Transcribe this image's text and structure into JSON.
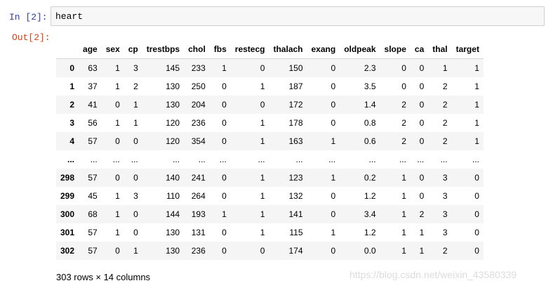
{
  "cell": {
    "input_prompt": "In  [2]:",
    "code": "heart",
    "output_prompt": "Out[2]:"
  },
  "dataframe": {
    "columns": [
      "age",
      "sex",
      "cp",
      "trestbps",
      "chol",
      "fbs",
      "restecg",
      "thalach",
      "exang",
      "oldpeak",
      "slope",
      "ca",
      "thal",
      "target"
    ],
    "rows": [
      {
        "index": "0",
        "values": [
          "63",
          "1",
          "3",
          "145",
          "233",
          "1",
          "0",
          "150",
          "0",
          "2.3",
          "0",
          "0",
          "1",
          "1"
        ]
      },
      {
        "index": "1",
        "values": [
          "37",
          "1",
          "2",
          "130",
          "250",
          "0",
          "1",
          "187",
          "0",
          "3.5",
          "0",
          "0",
          "2",
          "1"
        ]
      },
      {
        "index": "2",
        "values": [
          "41",
          "0",
          "1",
          "130",
          "204",
          "0",
          "0",
          "172",
          "0",
          "1.4",
          "2",
          "0",
          "2",
          "1"
        ]
      },
      {
        "index": "3",
        "values": [
          "56",
          "1",
          "1",
          "120",
          "236",
          "0",
          "1",
          "178",
          "0",
          "0.8",
          "2",
          "0",
          "2",
          "1"
        ]
      },
      {
        "index": "4",
        "values": [
          "57",
          "0",
          "0",
          "120",
          "354",
          "0",
          "1",
          "163",
          "1",
          "0.6",
          "2",
          "0",
          "2",
          "1"
        ]
      },
      {
        "index": "...",
        "values": [
          "...",
          "...",
          "...",
          "...",
          "...",
          "...",
          "...",
          "...",
          "...",
          "...",
          "...",
          "...",
          "...",
          "..."
        ]
      },
      {
        "index": "298",
        "values": [
          "57",
          "0",
          "0",
          "140",
          "241",
          "0",
          "1",
          "123",
          "1",
          "0.2",
          "1",
          "0",
          "3",
          "0"
        ]
      },
      {
        "index": "299",
        "values": [
          "45",
          "1",
          "3",
          "110",
          "264",
          "0",
          "1",
          "132",
          "0",
          "1.2",
          "1",
          "0",
          "3",
          "0"
        ]
      },
      {
        "index": "300",
        "values": [
          "68",
          "1",
          "0",
          "144",
          "193",
          "1",
          "1",
          "141",
          "0",
          "3.4",
          "1",
          "2",
          "3",
          "0"
        ]
      },
      {
        "index": "301",
        "values": [
          "57",
          "1",
          "0",
          "130",
          "131",
          "0",
          "1",
          "115",
          "1",
          "1.2",
          "1",
          "1",
          "3",
          "0"
        ]
      },
      {
        "index": "302",
        "values": [
          "57",
          "0",
          "1",
          "130",
          "236",
          "0",
          "0",
          "174",
          "0",
          "0.0",
          "1",
          "1",
          "2",
          "0"
        ]
      }
    ],
    "shape_text": "303 rows × 14 columns"
  },
  "watermark": "https://blog.csdn.net/weixin_43580339"
}
